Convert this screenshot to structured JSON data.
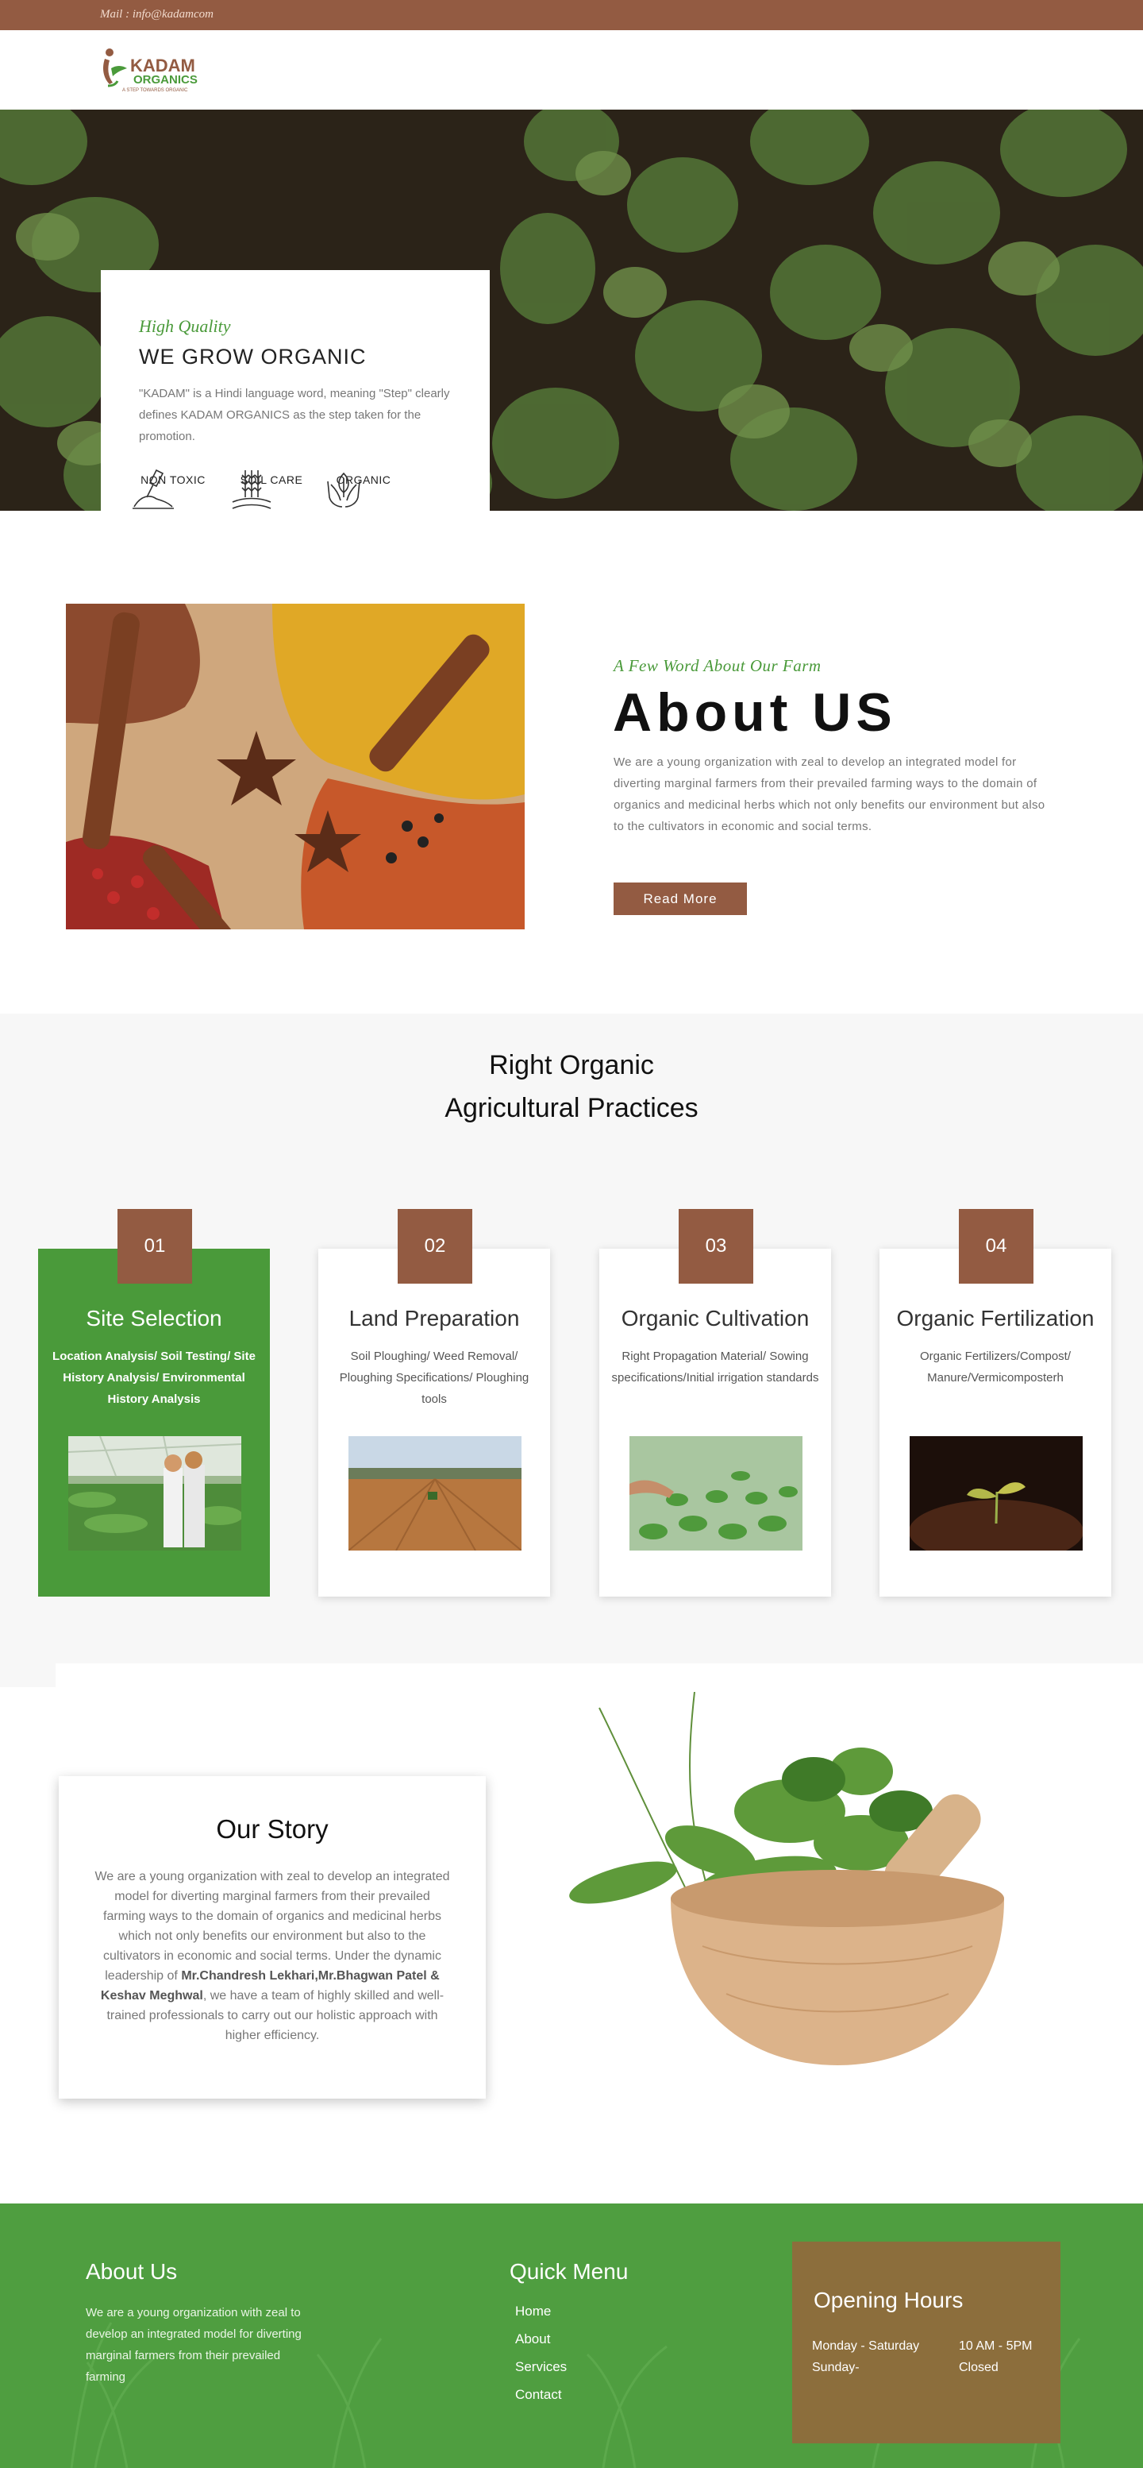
{
  "topbar": {
    "mail": "Mail : info@kadamcom"
  },
  "logo": {
    "line1": "KADAM",
    "line2": "ORGANICS",
    "tagline": "A STEP TOWARDS ORGANIC"
  },
  "hero": {
    "kicker": "High Quality",
    "title": "WE GROW ORGANIC",
    "description": "\"KADAM\" is a Hindi language word, meaning \"Step\" clearly defines KADAM ORGANICS as the step taken for the promotion.",
    "features": [
      {
        "label": "NON TOXIC",
        "icon": "shovel-soil-icon"
      },
      {
        "label": "SOIL CARE",
        "icon": "wheat-icon"
      },
      {
        "label": "ORGANIC",
        "icon": "hands-leaf-icon"
      }
    ]
  },
  "about": {
    "kicker": "A Few Word About Our Farm",
    "title": "About US",
    "text": "We are a young organization with zeal to develop an integrated model for diverting marginal farmers from their prevailed farming ways to the domain of organics and medicinal herbs which not only benefits our environment but also to the cultivators in economic and social terms.",
    "button": "Read More"
  },
  "practices": {
    "heading_line1": "Right Organic",
    "heading_line2": "Agricultural Practices",
    "cards": [
      {
        "num": "01",
        "title": "Site Selection",
        "sub": "Location Analysis/ Soil Testing/ Site History Analysis/ Environmental History Analysis"
      },
      {
        "num": "02",
        "title": "Land Preparation",
        "sub": "Soil Ploughing/ Weed Removal/ Ploughing Specifications/ Ploughing tools"
      },
      {
        "num": "03",
        "title": "Organic Cultivation",
        "sub": "Right Propagation Material/ Sowing specifications/Initial irrigation standards"
      },
      {
        "num": "04",
        "title": "Organic Fertilization",
        "sub": "Organic Fertilizers/Compost/ Manure/Vermicomposterh"
      }
    ]
  },
  "story": {
    "title": "Our Story",
    "text_before": "We are a young organization with zeal to develop an integrated model for diverting marginal farmers from their prevailed farming ways to the domain of organics and medicinal herbs which not only benefits our environment but also to the cultivators in economic and social terms. Under the dynamic leadership of ",
    "text_bold": "Mr.Chandresh Lekhari,Mr.Bhagwan Patel & Keshav Meghwal",
    "text_after": ", we have a team of highly skilled and well-trained professionals to carry out our holistic approach with higher efficiency."
  },
  "footer": {
    "about_title": "About Us",
    "about_text": "We are a young organization with zeal to develop an integrated model for diverting marginal farmers from their prevailed farming",
    "menu_title": "Quick Menu",
    "menu": [
      "Home",
      "About",
      "Services",
      "Contact"
    ],
    "hours_title": "Opening Hours",
    "hours": [
      {
        "day": "Monday - Saturday",
        "time": "10 AM - 5PM"
      },
      {
        "day": "Sunday-",
        "time": "Closed"
      }
    ]
  },
  "colors": {
    "brown": "#935b42",
    "green": "#4a9a3a",
    "footer_green": "#4f9e40",
    "hours_bg": "#8c6e3c"
  }
}
